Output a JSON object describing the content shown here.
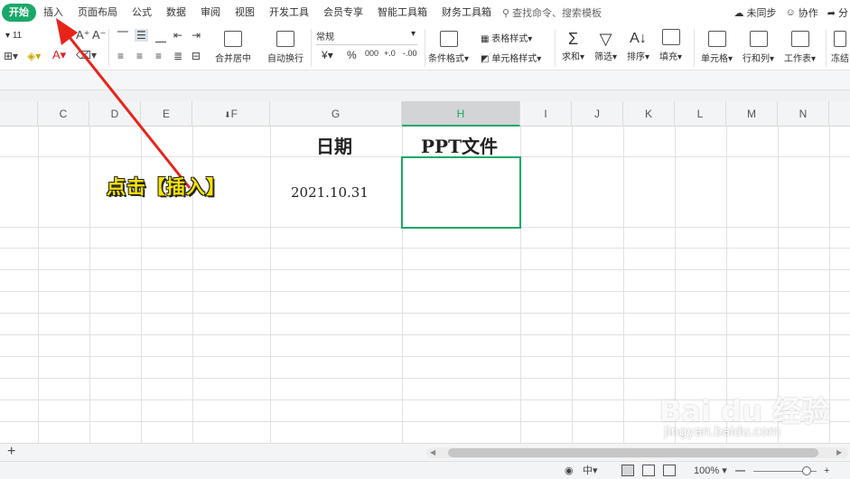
{
  "menu": {
    "tabs": [
      "开始",
      "插入",
      "页面布局",
      "公式",
      "数据",
      "审阅",
      "视图",
      "开发工具",
      "会员专享",
      "智能工具箱",
      "财务工具箱"
    ],
    "search_label": "查找命令、搜索模板",
    "right": {
      "sync": "未同步",
      "collab": "协作",
      "share": "分"
    }
  },
  "ribbon": {
    "font_size": "11",
    "merge_center": "合并居中",
    "wrap_text": "自动换行",
    "number_format": "常规",
    "currency": "¥",
    "percent": "%",
    "thousands": "000",
    "dec_inc": "+.0",
    "dec_dec": "-.00",
    "cond_format": "条件格式",
    "table_style": "表格样式",
    "cell_style": "单元格样式",
    "sum": "求和",
    "filter": "筛选",
    "sort": "排序",
    "fill": "填充",
    "cell": "单元格",
    "rowcol": "行和列",
    "worksheet": "工作表",
    "freeze": "冻结"
  },
  "columns": [
    "C",
    "D",
    "E",
    "F",
    "G",
    "H",
    "I",
    "J",
    "K",
    "L",
    "M",
    "N"
  ],
  "selected_column": "H",
  "cells": {
    "header_date": "日期",
    "header_ppt": "PPT文件",
    "date_value": "2021.10.31"
  },
  "annotation": {
    "text": "点击【插入】",
    "color": "#f5e300"
  },
  "statusbar": {
    "zoom": "100%"
  },
  "watermark": {
    "brand": "Bai du 经验",
    "url": "jingyan.baidu.com"
  },
  "colors": {
    "accent": "#1aa869",
    "arrow": "#e8231a"
  }
}
